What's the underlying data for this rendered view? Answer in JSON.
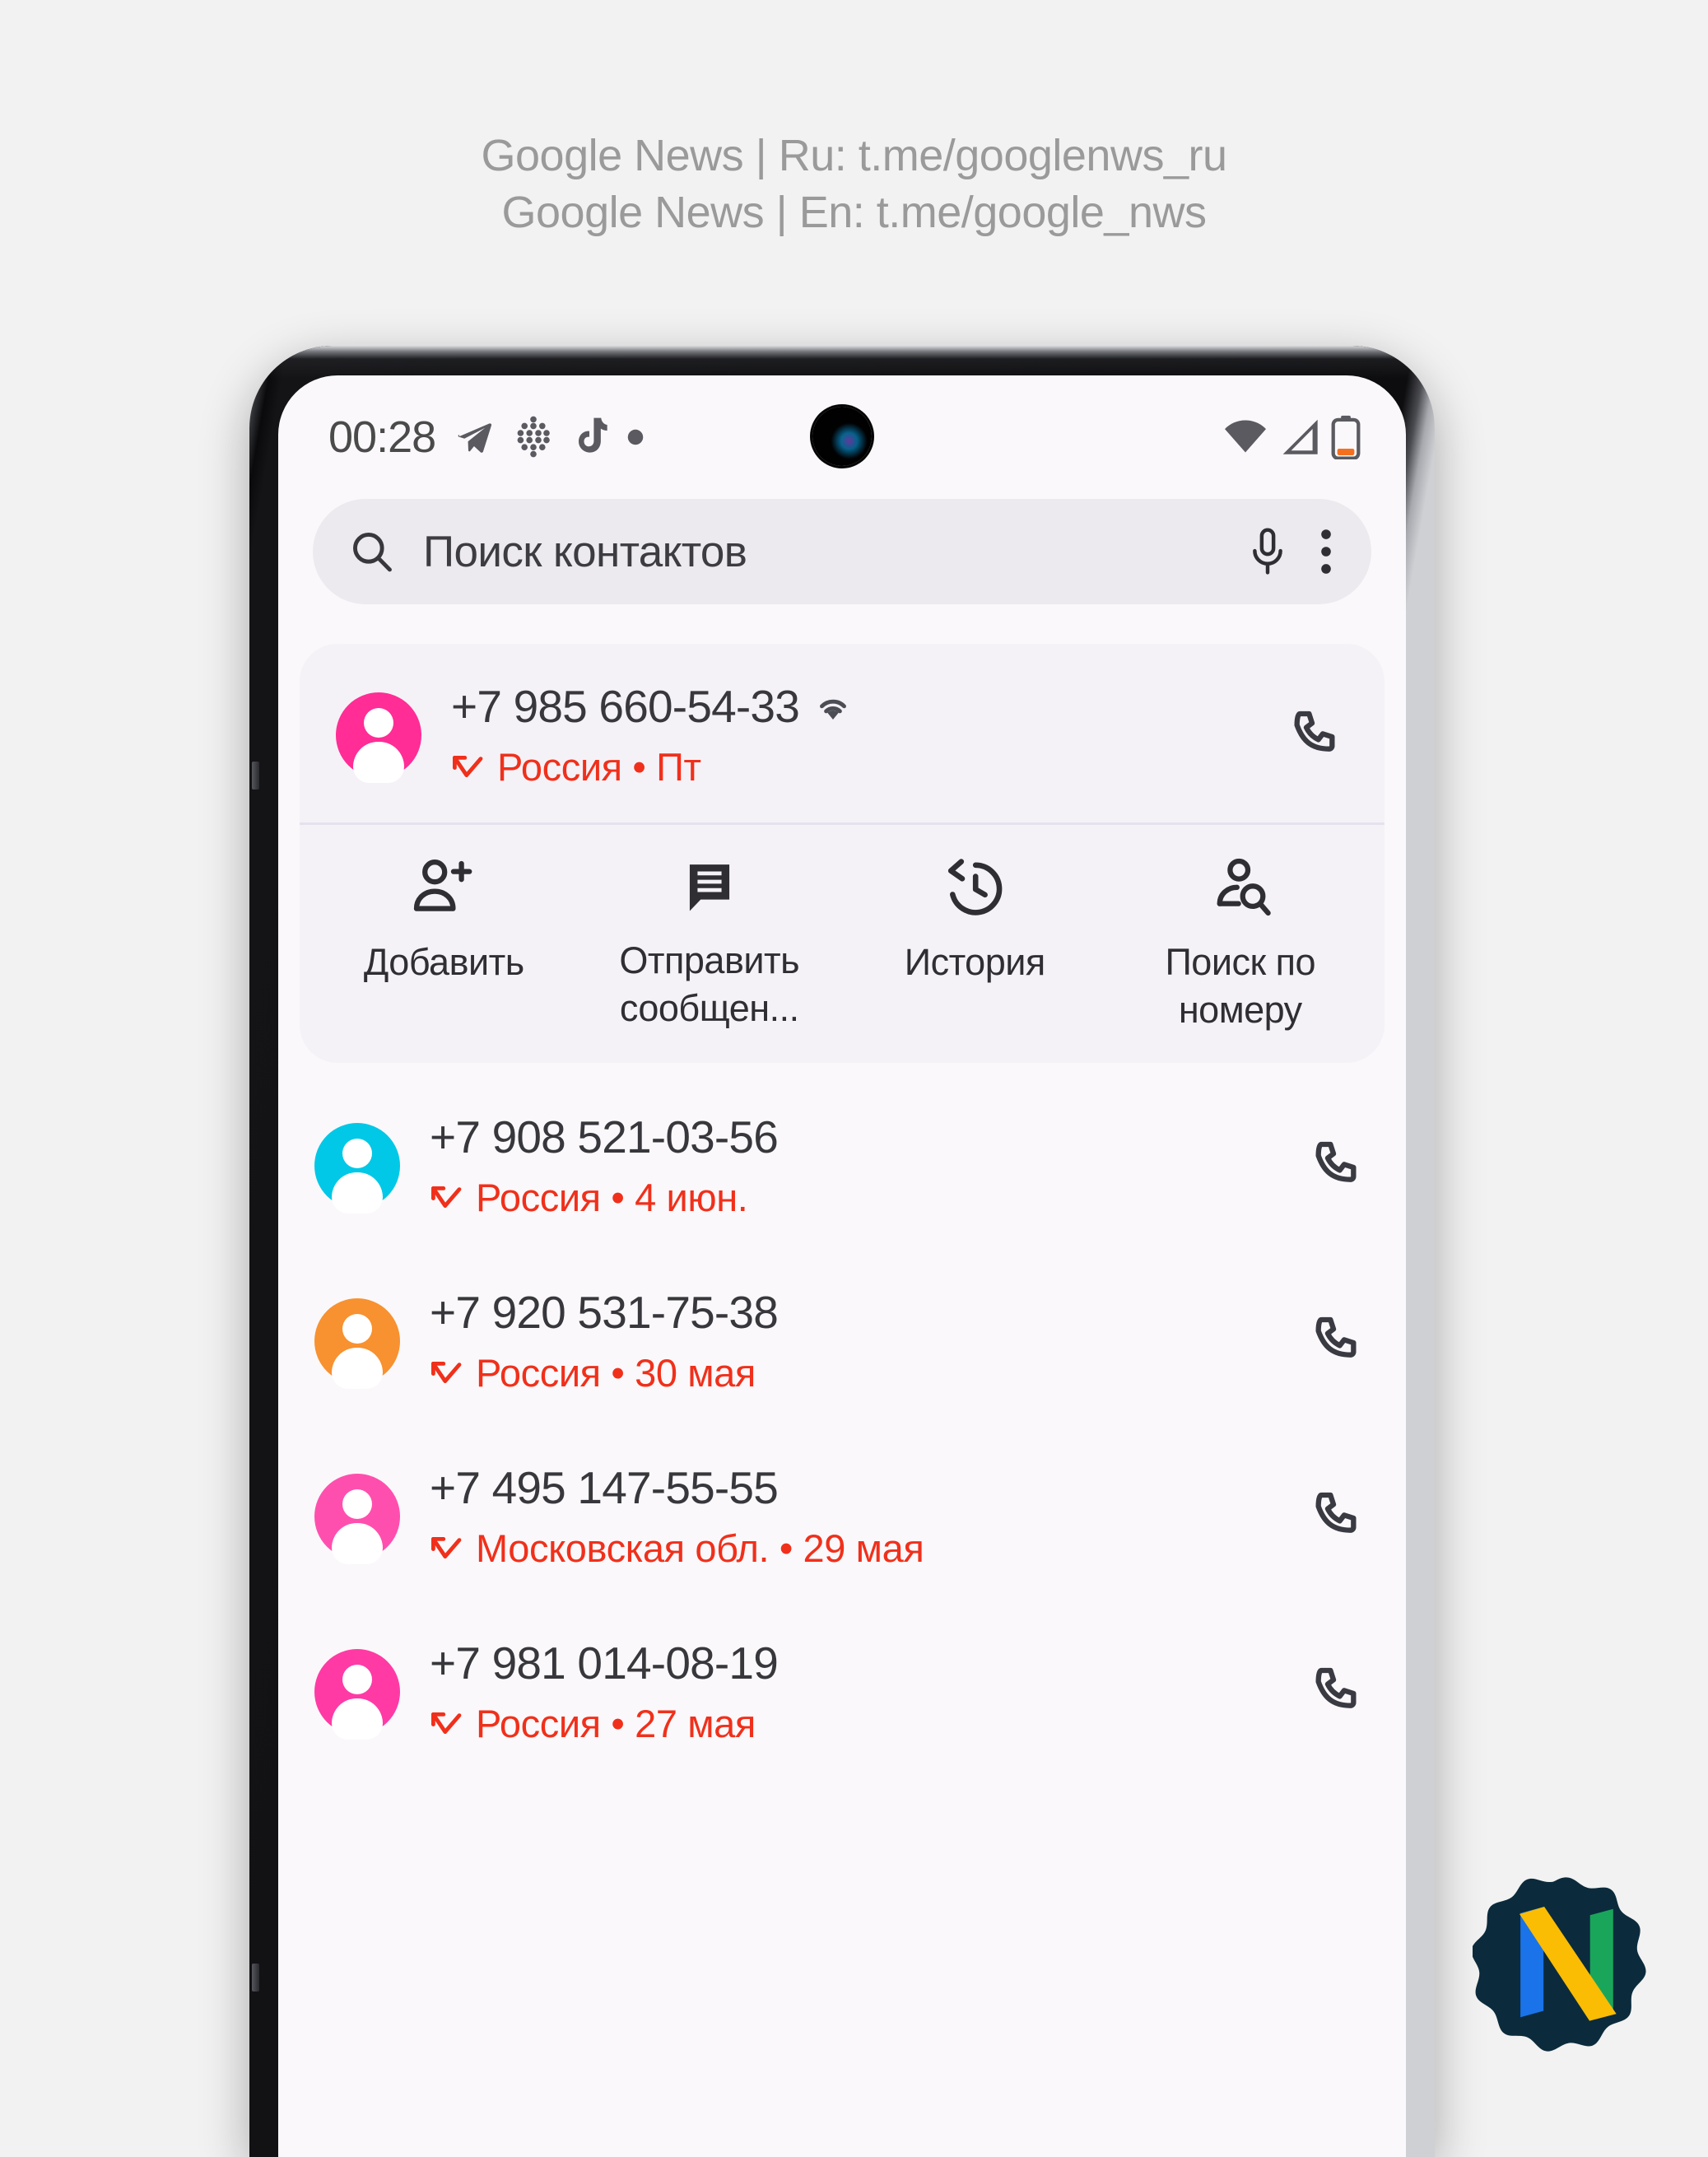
{
  "header": {
    "line1": "Google News | Ru: t.me/googlenws_ru",
    "line2": "Google News | En: t.me/google_nws"
  },
  "status_bar": {
    "clock": "00:28",
    "icons": [
      "telegram-icon",
      "dots-grid-icon",
      "tiktok-icon",
      "dot-icon"
    ],
    "right_icons": [
      "wifi-icon",
      "signal-icon",
      "battery-low-icon"
    ],
    "battery_color": "#f4701f"
  },
  "search": {
    "placeholder": "Поиск контактов",
    "value": "",
    "search_icon": "search-icon",
    "mic_icon": "microphone-icon",
    "overflow_icon": "more-vert-icon"
  },
  "selected_contact": {
    "number": "+7 985 660-54-33",
    "subtitle": "Россия • Пт",
    "avatar_color": "#ff2d95",
    "wifi_calling": true,
    "call_icon": "phone-icon",
    "call_type_icon": "missed-incoming-call-icon"
  },
  "actions": [
    {
      "label": "Добавить",
      "icon": "person-add-icon"
    },
    {
      "label": "Отправить сообщен...",
      "icon": "message-icon"
    },
    {
      "label": "История",
      "icon": "history-icon"
    },
    {
      "label": "Поиск по номеру",
      "icon": "person-search-icon"
    }
  ],
  "contacts": [
    {
      "number": "+7 908 521-03-56",
      "subtitle": "Россия • 4 июн.",
      "avatar_color": "#00c8e6",
      "call_icon": "phone-icon",
      "call_type_icon": "missed-incoming-call-icon"
    },
    {
      "number": "+7 920 531-75-38",
      "subtitle": "Россия • 30 мая",
      "avatar_color": "#f8912f",
      "call_icon": "phone-icon",
      "call_type_icon": "missed-incoming-call-icon"
    },
    {
      "number": "+7 495 147-55-55",
      "subtitle": "Московская обл. • 29 мая",
      "avatar_color": "#ff4fae",
      "call_icon": "phone-icon",
      "call_type_icon": "missed-incoming-call-icon"
    },
    {
      "number": "+7 981 014-08-19",
      "subtitle": "Россия • 27 мая",
      "avatar_color": "#ff3aa5",
      "call_icon": "phone-icon",
      "call_type_icon": "missed-incoming-call-icon"
    }
  ],
  "logo": {
    "name": "google-news-logo",
    "badge_color": "#0b2b3c",
    "blue": "#1a73e8",
    "yellow": "#fbbc04",
    "green": "#1aa65a"
  },
  "colors": {
    "screen_bg": "#faf8fa",
    "card_bg": "#f5f2f7",
    "search_bg": "#eceaee",
    "accent_red": "#f0301b",
    "text_primary": "#37373c"
  }
}
